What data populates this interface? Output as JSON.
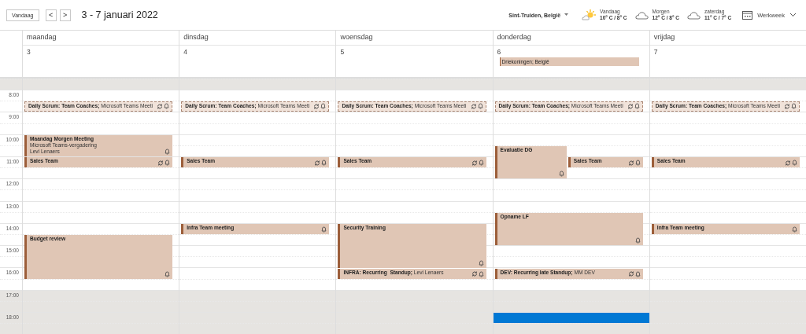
{
  "toolbar": {
    "today_button": "Vandaag",
    "prev_button": "<",
    "next_button": ">",
    "date_range": "3 - 7 januari 2022"
  },
  "location": {
    "label": "Sint-Truiden, België"
  },
  "weather": [
    {
      "kind": "sun",
      "day": "Vandaag",
      "temps": "10° C / 8° C"
    },
    {
      "kind": "cloud",
      "day": "Morgen",
      "temps": "12° C / 8° C"
    },
    {
      "kind": "cloud",
      "day": "zaterdag",
      "temps": "11° C / 7° C"
    }
  ],
  "view_switch": {
    "label": "Werkweek"
  },
  "time_slots": [
    {
      "off_hours": true
    },
    {
      "label": "8:00",
      "off_hours": false
    },
    {
      "off_hours": false
    },
    {
      "label": "9:00",
      "off_hours": false
    },
    {
      "off_hours": false
    },
    {
      "label": "10:00",
      "off_hours": false
    },
    {
      "off_hours": false
    },
    {
      "label": "11:00",
      "off_hours": false
    },
    {
      "off_hours": false
    },
    {
      "label": "12:00",
      "off_hours": false
    },
    {
      "off_hours": false
    },
    {
      "label": "13:00",
      "off_hours": false
    },
    {
      "off_hours": false
    },
    {
      "label": "14:00",
      "off_hours": false
    },
    {
      "off_hours": false
    },
    {
      "label": "15:00",
      "off_hours": false
    },
    {
      "off_hours": false
    },
    {
      "label": "16:00",
      "off_hours": false
    },
    {
      "off_hours": false
    },
    {
      "label": "17:00",
      "off_hours": true
    },
    {
      "off_hours": true
    },
    {
      "label": "18:00",
      "off_hours": true
    },
    {
      "off_hours": true
    }
  ],
  "days": [
    {
      "name": "maandag",
      "date": "3",
      "slots": [
        {
          "off_hours": true,
          "selected": false
        },
        {
          "off_hours": false,
          "selected": false
        },
        {
          "off_hours": false,
          "selected": false,
          "events": [
            {
              "kind": "tentative",
              "title": "Daily Scrum: Team Coaches;",
              "details": [
                "Microsoft Teams Meeti"
              ],
              "shares_row": false,
              "recurring": true,
              "reminder": true
            }
          ]
        },
        {
          "off_hours": false,
          "selected": false
        },
        {
          "off_hours": false,
          "selected": false
        },
        {
          "off_hours": false,
          "selected": false,
          "events": [
            {
              "kind": "hour",
              "title": "Maandag Morgen Meeting",
              "details": [
                "Microsoft Teams-vergadering",
                "Levi Lenaers"
              ],
              "shares_row": false,
              "recurring": false,
              "reminder": true
            }
          ]
        },
        {
          "off_hours": false,
          "selected": false
        },
        {
          "off_hours": false,
          "selected": false,
          "events": [
            {
              "kind": "half",
              "title": "Sales Team",
              "shares_row": false,
              "recurring": true,
              "reminder": true
            }
          ]
        },
        {
          "off_hours": false,
          "selected": false
        },
        {
          "off_hours": false,
          "selected": false
        },
        {
          "off_hours": false,
          "selected": false
        },
        {
          "off_hours": false,
          "selected": false
        },
        {
          "off_hours": false,
          "selected": false
        },
        {
          "off_hours": false,
          "selected": false
        },
        {
          "off_hours": false,
          "selected": false,
          "events": [
            {
              "kind": "double",
              "title": "Budget review",
              "shares_row": false,
              "recurring": false,
              "reminder": true
            }
          ]
        },
        {
          "off_hours": false,
          "selected": false
        },
        {
          "off_hours": false,
          "selected": false
        },
        {
          "off_hours": false,
          "selected": false
        },
        {
          "off_hours": false,
          "selected": false
        },
        {
          "off_hours": true,
          "selected": false
        },
        {
          "off_hours": true,
          "selected": false
        },
        {
          "off_hours": true,
          "selected": false
        },
        {
          "off_hours": true,
          "selected": false
        }
      ]
    },
    {
      "name": "dinsdag",
      "date": "4",
      "slots": [
        {
          "off_hours": true,
          "selected": false
        },
        {
          "off_hours": false,
          "selected": false
        },
        {
          "off_hours": false,
          "selected": false,
          "events": [
            {
              "kind": "tentative",
              "title": "Daily Scrum: Team Coaches;",
              "details": [
                "Microsoft Teams Meeti"
              ],
              "shares_row": false,
              "recurring": true,
              "reminder": true
            }
          ]
        },
        {
          "off_hours": false,
          "selected": false
        },
        {
          "off_hours": false,
          "selected": false
        },
        {
          "off_hours": false,
          "selected": false
        },
        {
          "off_hours": false,
          "selected": false
        },
        {
          "off_hours": false,
          "selected": false,
          "events": [
            {
              "kind": "half",
              "title": "Sales Team",
              "shares_row": false,
              "recurring": true,
              "reminder": true
            }
          ]
        },
        {
          "off_hours": false,
          "selected": false
        },
        {
          "off_hours": false,
          "selected": false
        },
        {
          "off_hours": false,
          "selected": false
        },
        {
          "off_hours": false,
          "selected": false
        },
        {
          "off_hours": false,
          "selected": false
        },
        {
          "off_hours": false,
          "selected": false,
          "events": [
            {
              "kind": "half",
              "title": "Infra Team meeting",
              "shares_row": false,
              "recurring": false,
              "reminder": true
            }
          ]
        },
        {
          "off_hours": false,
          "selected": false
        },
        {
          "off_hours": false,
          "selected": false
        },
        {
          "off_hours": false,
          "selected": false
        },
        {
          "off_hours": false,
          "selected": false
        },
        {
          "off_hours": false,
          "selected": false
        },
        {
          "off_hours": true,
          "selected": false
        },
        {
          "off_hours": true,
          "selected": false
        },
        {
          "off_hours": true,
          "selected": false
        },
        {
          "off_hours": true,
          "selected": false
        }
      ]
    },
    {
      "name": "woensdag",
      "date": "5",
      "slots": [
        {
          "off_hours": true,
          "selected": false
        },
        {
          "off_hours": false,
          "selected": false
        },
        {
          "off_hours": false,
          "selected": false,
          "events": [
            {
              "kind": "tentative",
              "title": "Daily Scrum: Team Coaches;",
              "details": [
                "Microsoft Teams Meeti"
              ],
              "shares_row": false,
              "recurring": true,
              "reminder": true
            }
          ]
        },
        {
          "off_hours": false,
          "selected": false
        },
        {
          "off_hours": false,
          "selected": false
        },
        {
          "off_hours": false,
          "selected": false
        },
        {
          "off_hours": false,
          "selected": false
        },
        {
          "off_hours": false,
          "selected": false,
          "events": [
            {
              "kind": "half",
              "title": "Sales Team",
              "shares_row": false,
              "recurring": true,
              "reminder": true
            }
          ]
        },
        {
          "off_hours": false,
          "selected": false
        },
        {
          "off_hours": false,
          "selected": false
        },
        {
          "off_hours": false,
          "selected": false
        },
        {
          "off_hours": false,
          "selected": false
        },
        {
          "off_hours": false,
          "selected": false
        },
        {
          "off_hours": false,
          "selected": false,
          "events": [
            {
              "kind": "double",
              "title": "Security Training",
              "shares_row": false,
              "recurring": false,
              "reminder": true
            }
          ]
        },
        {
          "off_hours": false,
          "selected": false
        },
        {
          "off_hours": false,
          "selected": false
        },
        {
          "off_hours": false,
          "selected": false
        },
        {
          "off_hours": false,
          "selected": false,
          "events": [
            {
              "kind": "half",
              "title": "INFRA: Recurring  Standup;",
              "details": [
                "Levi Lenaers"
              ],
              "shares_row": false,
              "recurring": true,
              "reminder": true
            }
          ]
        },
        {
          "off_hours": false,
          "selected": false
        },
        {
          "off_hours": true,
          "selected": false
        },
        {
          "off_hours": true,
          "selected": false
        },
        {
          "off_hours": true,
          "selected": false
        },
        {
          "off_hours": true,
          "selected": false
        }
      ]
    },
    {
      "name": "donderdag",
      "date": "6",
      "all_day": [
        {
          "kind": "free",
          "title": "Driekoningen; België"
        }
      ],
      "slots": [
        {
          "off_hours": true,
          "selected": false
        },
        {
          "off_hours": false,
          "selected": false
        },
        {
          "off_hours": false,
          "selected": false,
          "events": [
            {
              "kind": "tentative",
              "title": "Daily Scrum: Team Coaches;",
              "details": [
                "Microsoft Teams Meeti"
              ],
              "shares_row": false,
              "recurring": true,
              "reminder": true
            }
          ]
        },
        {
          "off_hours": false,
          "selected": false
        },
        {
          "off_hours": false,
          "selected": false
        },
        {
          "off_hours": false,
          "selected": false
        },
        {
          "off_hours": false,
          "selected": false,
          "events": [
            {
              "kind": "ninety",
              "title": "Evaluatie DG",
              "shares_row": true,
              "recurring": false,
              "reminder": true
            }
          ]
        },
        {
          "off_hours": false,
          "selected": false,
          "events": [
            {
              "kind": "half",
              "title": "Sales Team",
              "shares_row": true,
              "recurring": true,
              "reminder": true
            }
          ]
        },
        {
          "off_hours": false,
          "selected": false
        },
        {
          "off_hours": false,
          "selected": false
        },
        {
          "off_hours": false,
          "selected": false
        },
        {
          "off_hours": false,
          "selected": false
        },
        {
          "off_hours": false,
          "selected": false,
          "events": [
            {
              "kind": "ninety",
              "title": "Opname LF",
              "shares_row": false,
              "recurring": false,
              "reminder": true
            }
          ]
        },
        {
          "off_hours": false,
          "selected": false
        },
        {
          "off_hours": false,
          "selected": false
        },
        {
          "off_hours": false,
          "selected": false
        },
        {
          "off_hours": false,
          "selected": false
        },
        {
          "off_hours": false,
          "selected": false,
          "events": [
            {
              "kind": "half",
              "title": "DEV: Recurring late Standup;",
              "details": [
                "MM DEV"
              ],
              "shares_row": false,
              "recurring": true,
              "reminder": true
            }
          ]
        },
        {
          "off_hours": false,
          "selected": false
        },
        {
          "off_hours": true,
          "selected": false
        },
        {
          "off_hours": true,
          "selected": false
        },
        {
          "off_hours": true,
          "selected": true
        },
        {
          "off_hours": true,
          "selected": false
        }
      ]
    },
    {
      "name": "vrijdag",
      "date": "7",
      "slots": [
        {
          "off_hours": true,
          "selected": false
        },
        {
          "off_hours": false,
          "selected": false
        },
        {
          "off_hours": false,
          "selected": false,
          "events": [
            {
              "kind": "tentative",
              "title": "Daily Scrum: Team Coaches;",
              "details": [
                "Microsoft Teams Meeti"
              ],
              "shares_row": false,
              "recurring": true,
              "reminder": true
            }
          ]
        },
        {
          "off_hours": false,
          "selected": false
        },
        {
          "off_hours": false,
          "selected": false
        },
        {
          "off_hours": false,
          "selected": false
        },
        {
          "off_hours": false,
          "selected": false
        },
        {
          "off_hours": false,
          "selected": false,
          "events": [
            {
              "kind": "half",
              "title": "Sales Team",
              "shares_row": false,
              "recurring": true,
              "reminder": true
            }
          ]
        },
        {
          "off_hours": false,
          "selected": false
        },
        {
          "off_hours": false,
          "selected": false
        },
        {
          "off_hours": false,
          "selected": false
        },
        {
          "off_hours": false,
          "selected": false
        },
        {
          "off_hours": false,
          "selected": false
        },
        {
          "off_hours": false,
          "selected": false,
          "events": [
            {
              "kind": "half",
              "title": "Infra Team meeting",
              "shares_row": false,
              "recurring": false,
              "reminder": true
            }
          ]
        },
        {
          "off_hours": false,
          "selected": false
        },
        {
          "off_hours": false,
          "selected": false
        },
        {
          "off_hours": false,
          "selected": false
        },
        {
          "off_hours": false,
          "selected": false
        },
        {
          "off_hours": false,
          "selected": false
        },
        {
          "off_hours": true,
          "selected": false
        },
        {
          "off_hours": true,
          "selected": false
        },
        {
          "off_hours": true,
          "selected": false
        },
        {
          "off_hours": true,
          "selected": false
        }
      ]
    }
  ]
}
